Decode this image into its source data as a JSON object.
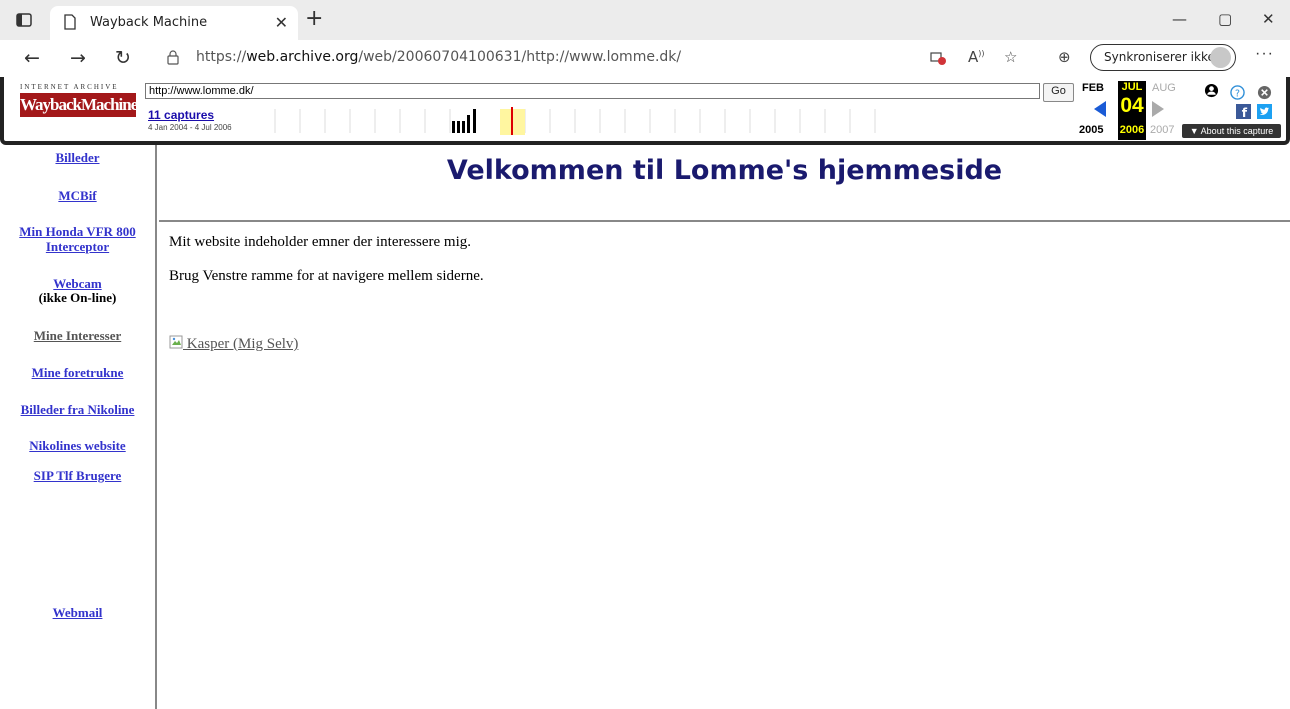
{
  "browser": {
    "tab_title": "Wayback Machine",
    "url_prefix": "https://",
    "url_domain": "web.archive.org",
    "url_path": "/web/20060704100631/http://www.lomme.dk/",
    "sync_label": "Synkroniserer ikke",
    "icons": [
      "tab-actions-icon",
      "page-icon",
      "close-icon",
      "new-tab-icon",
      "minimize-icon",
      "maximize-icon",
      "window-close-icon",
      "back-icon",
      "forward-icon",
      "refresh-icon",
      "lock-icon",
      "tracking-icon",
      "read-aloud-icon",
      "favorites-icon",
      "collections-icon",
      "more-icon"
    ]
  },
  "wayback": {
    "logo_top": "INTERNET ARCHIVE",
    "logo": "WaybackMachine",
    "url_value": "http://www.lomme.dk/",
    "go_label": "Go",
    "captures_label": "11 captures",
    "date_range": "4 Jan 2004 - 4 Jul 2006",
    "prev_month": "FEB",
    "cur_month": "JUL",
    "next_month": "AUG",
    "cur_day": "04",
    "prev_year": "2005",
    "cur_year": "2006",
    "next_year": "2007",
    "about_label": "▼ About this capture",
    "accent": "#a3181a"
  },
  "sidebar": {
    "items": [
      {
        "label": "Billeder"
      },
      {
        "label": "MCBif"
      },
      {
        "label": "Min Honda VFR 800"
      },
      {
        "label": "Interceptor"
      },
      {
        "label": "Webcam"
      },
      {
        "label": "(ikke On-line)"
      },
      {
        "label": "Mine Interesser"
      },
      {
        "label": "Mine foretrukne"
      },
      {
        "label": "Billeder fra Nikoline"
      },
      {
        "label": "Nikolines website"
      },
      {
        "label": "SIP Tlf Brugere"
      },
      {
        "label": "Webmail"
      }
    ]
  },
  "page": {
    "title": "Velkommen til Lomme's hjemmeside",
    "line1": "Mit website indeholder emner der interessere mig.",
    "line2": "Brug Venstre ramme for at navigere mellem siderne.",
    "image_alt": " Kasper (Mig Selv)"
  }
}
